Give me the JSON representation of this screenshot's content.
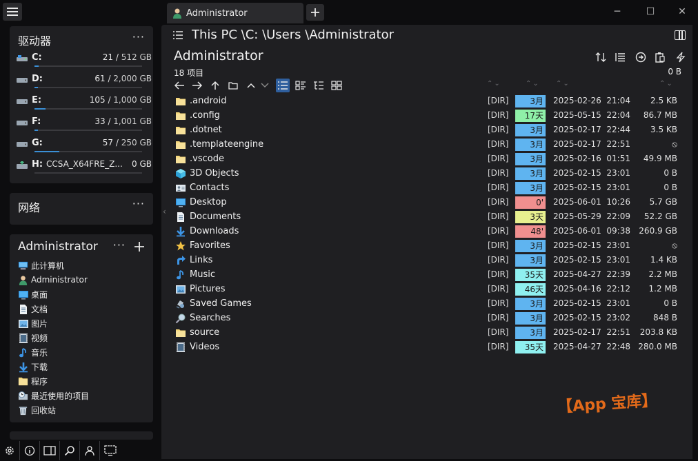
{
  "tab": {
    "title": "Administrator",
    "new_tab": "+"
  },
  "window": {
    "minimize": "─",
    "maximize": "☐",
    "close": "✕"
  },
  "drives_panel": {
    "title": "驱动器",
    "more": "···",
    "drives": [
      {
        "letter": "C:",
        "name": "",
        "used": "21",
        "total": "512 GB",
        "fill": 0.04,
        "icon": "system-drive-icon"
      },
      {
        "letter": "D:",
        "name": "",
        "used": "61",
        "total": "2,000 GB",
        "fill": 0.03,
        "icon": "drive-icon"
      },
      {
        "letter": "E:",
        "name": "",
        "used": "105",
        "total": "1,000 GB",
        "fill": 0.105,
        "icon": "drive-icon"
      },
      {
        "letter": "F:",
        "name": "",
        "used": "33",
        "total": "1,001 GB",
        "fill": 0.033,
        "icon": "drive-icon"
      },
      {
        "letter": "G:",
        "name": "",
        "used": "57",
        "total": "250 GB",
        "fill": 0.228,
        "icon": "drive-icon"
      },
      {
        "letter": "H:",
        "name": "CCSA_X64FRE_Z...",
        "used": "0 GB",
        "total": "",
        "fill": 0.0,
        "icon": "removable-drive-icon"
      }
    ]
  },
  "network_panel": {
    "title": "网络",
    "more": "···"
  },
  "user_panel": {
    "title": "Administrator",
    "more": "···",
    "add": "+",
    "items": [
      {
        "label": "此计算机",
        "icon": "computer-icon"
      },
      {
        "label": "Administrator",
        "icon": "user-icon"
      },
      {
        "label": "桌面",
        "icon": "desktop-icon"
      },
      {
        "label": "文档",
        "icon": "documents-icon"
      },
      {
        "label": "图片",
        "icon": "pictures-icon"
      },
      {
        "label": "视频",
        "icon": "videos-icon"
      },
      {
        "label": "音乐",
        "icon": "music-icon"
      },
      {
        "label": "下载",
        "icon": "downloads-icon"
      },
      {
        "label": "程序",
        "icon": "programs-icon"
      },
      {
        "label": "最近使用的项目",
        "icon": "recent-icon"
      },
      {
        "label": "回收站",
        "icon": "recycle-bin-icon"
      }
    ]
  },
  "main": {
    "path": "This PC \\C: \\Users \\Administrator",
    "folder_title": "Administrator",
    "item_count": "18 项目",
    "total_size": "0 B",
    "files": [
      {
        "name": ".android",
        "type": "[DIR]",
        "age": "3月",
        "age_color": "#5fb4f0",
        "date": "2025-02-26",
        "time": "21:04",
        "size": "2.5 KB",
        "icon": "folder-icon"
      },
      {
        "name": ".config",
        "type": "[DIR]",
        "age": "17天",
        "age_color": "#8ff0a8",
        "date": "2025-05-15",
        "time": "22:04",
        "size": "86.7 MB",
        "icon": "folder-icon"
      },
      {
        "name": ".dotnet",
        "type": "[DIR]",
        "age": "3月",
        "age_color": "#5fb4f0",
        "date": "2025-02-17",
        "time": "22:44",
        "size": "3.5 KB",
        "icon": "folder-icon"
      },
      {
        "name": ".templateengine",
        "type": "[DIR]",
        "age": "3月",
        "age_color": "#5fb4f0",
        "date": "2025-02-17",
        "time": "22:51",
        "size": "⦸",
        "icon": "folder-icon"
      },
      {
        "name": ".vscode",
        "type": "[DIR]",
        "age": "3月",
        "age_color": "#5fb4f0",
        "date": "2025-02-16",
        "time": "01:51",
        "size": "49.9 MB",
        "icon": "folder-icon"
      },
      {
        "name": "3D Objects",
        "type": "[DIR]",
        "age": "3月",
        "age_color": "#5fb4f0",
        "date": "2025-02-15",
        "time": "23:01",
        "size": "0 B",
        "icon": "3d-objects-icon"
      },
      {
        "name": "Contacts",
        "type": "[DIR]",
        "age": "3月",
        "age_color": "#5fb4f0",
        "date": "2025-02-15",
        "time": "23:01",
        "size": "0 B",
        "icon": "contacts-icon"
      },
      {
        "name": "Desktop",
        "type": "[DIR]",
        "age": "0'",
        "age_color": "#f08f8f",
        "date": "2025-06-01",
        "time": "10:26",
        "size": "5.7 GB",
        "icon": "desktop-icon"
      },
      {
        "name": "Documents",
        "type": "[DIR]",
        "age": "3天",
        "age_color": "#e8f08f",
        "date": "2025-05-29",
        "time": "22:09",
        "size": "52.2 GB",
        "icon": "documents-icon"
      },
      {
        "name": "Downloads",
        "type": "[DIR]",
        "age": "48'",
        "age_color": "#f08f8f",
        "date": "2025-06-01",
        "time": "09:38",
        "size": "260.9 GB",
        "icon": "downloads-icon"
      },
      {
        "name": "Favorites",
        "type": "[DIR]",
        "age": "3月",
        "age_color": "#5fb4f0",
        "date": "2025-02-15",
        "time": "23:01",
        "size": "⦸",
        "icon": "favorites-icon"
      },
      {
        "name": "Links",
        "type": "[DIR]",
        "age": "3月",
        "age_color": "#5fb4f0",
        "date": "2025-02-15",
        "time": "23:01",
        "size": "1.4 KB",
        "icon": "links-icon"
      },
      {
        "name": "Music",
        "type": "[DIR]",
        "age": "35天",
        "age_color": "#8ff0f0",
        "date": "2025-04-27",
        "time": "22:39",
        "size": "2.2 MB",
        "icon": "music-icon"
      },
      {
        "name": "Pictures",
        "type": "[DIR]",
        "age": "46天",
        "age_color": "#8ff0f0",
        "date": "2025-04-16",
        "time": "22:12",
        "size": "1.2 MB",
        "icon": "pictures-icon"
      },
      {
        "name": "Saved Games",
        "type": "[DIR]",
        "age": "3月",
        "age_color": "#5fb4f0",
        "date": "2025-02-15",
        "time": "23:01",
        "size": "0 B",
        "icon": "saved-games-icon"
      },
      {
        "name": "Searches",
        "type": "[DIR]",
        "age": "3月",
        "age_color": "#5fb4f0",
        "date": "2025-02-15",
        "time": "23:02",
        "size": "848 B",
        "icon": "searches-icon"
      },
      {
        "name": "source",
        "type": "[DIR]",
        "age": "3月",
        "age_color": "#5fb4f0",
        "date": "2025-02-17",
        "time": "22:51",
        "size": "203.8 KB",
        "icon": "folder-icon"
      },
      {
        "name": "Videos",
        "type": "[DIR]",
        "age": "35天",
        "age_color": "#8ff0f0",
        "date": "2025-04-27",
        "time": "22:48",
        "size": "280.0 MB",
        "icon": "videos-icon"
      }
    ]
  },
  "watermark": "【App 宝库】",
  "colors": {
    "accent": "#3a8fd6",
    "panel": "#1f1f22",
    "bg": "#0d0d0f",
    "folder": "#f5d77a"
  }
}
